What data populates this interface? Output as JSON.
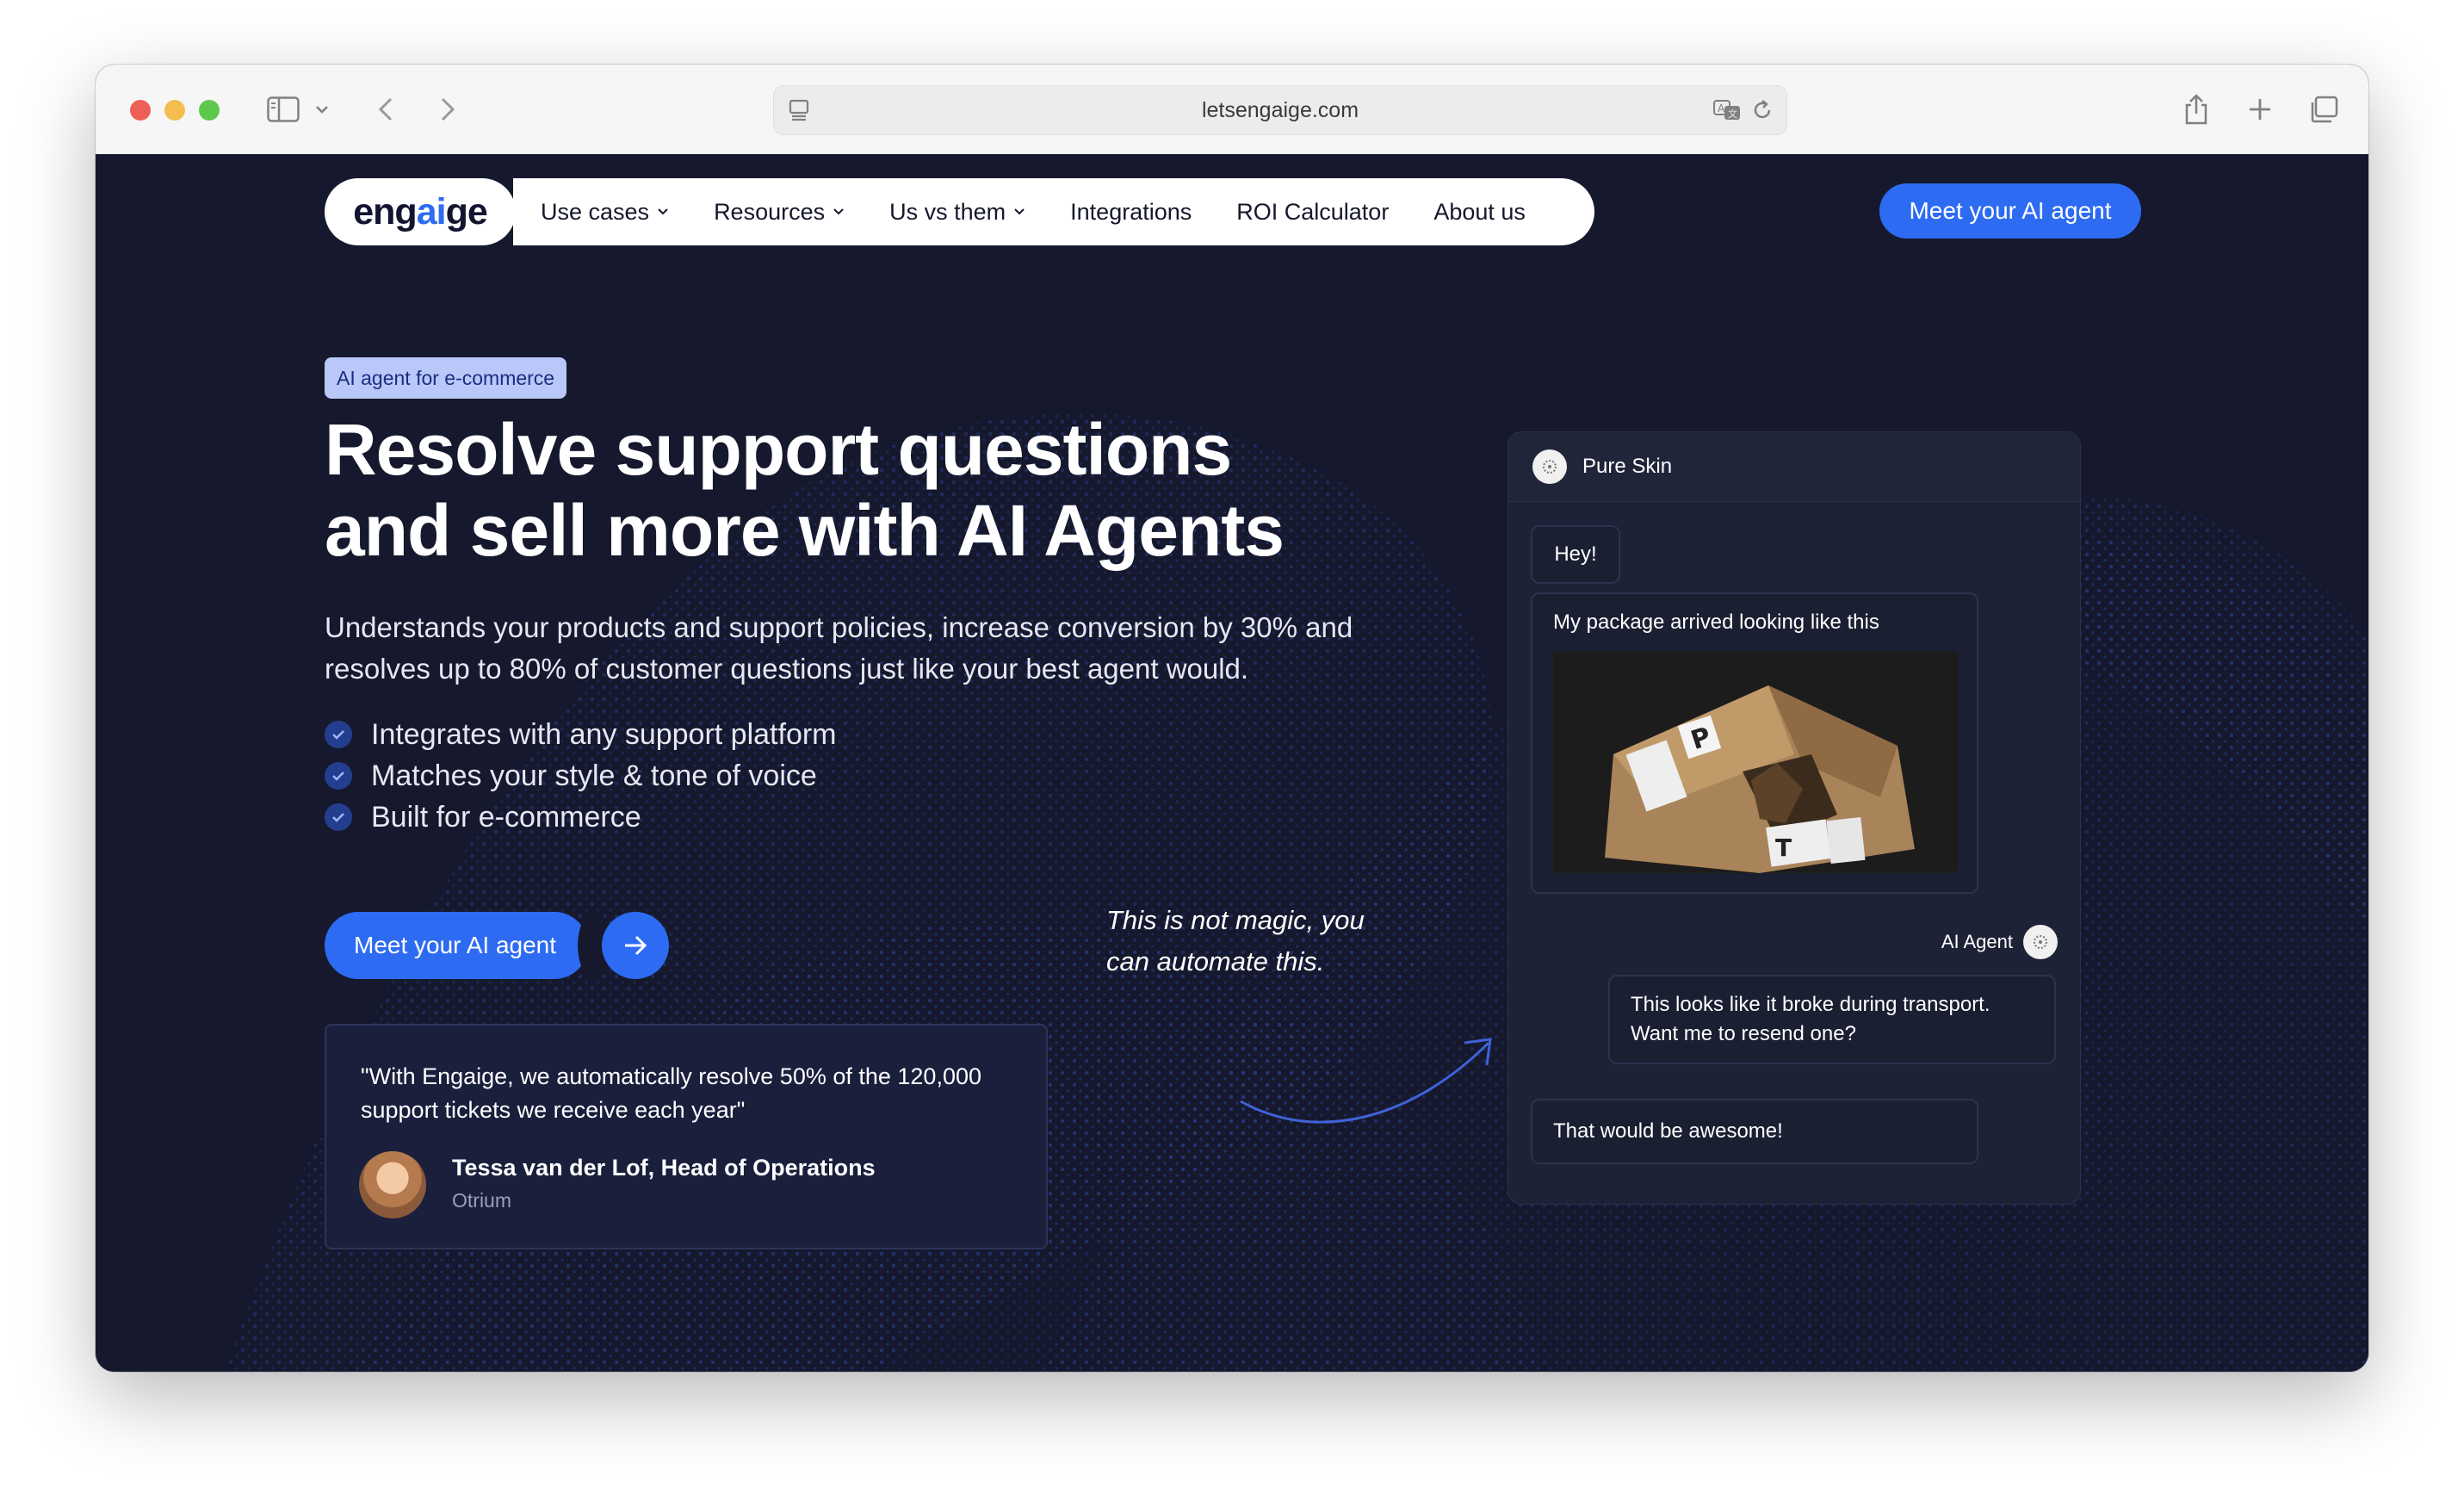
{
  "browser": {
    "url": "letsengaige.com"
  },
  "nav": {
    "logo_pre": "eng",
    "logo_ai": "ai",
    "logo_post": "ge",
    "items": [
      {
        "label": "Use cases",
        "has_dropdown": true
      },
      {
        "label": "Resources",
        "has_dropdown": true
      },
      {
        "label": "Us vs them",
        "has_dropdown": true
      },
      {
        "label": "Integrations",
        "has_dropdown": false
      },
      {
        "label": "ROI Calculator",
        "has_dropdown": false
      },
      {
        "label": "About us",
        "has_dropdown": false
      }
    ],
    "cta": "Meet your AI agent"
  },
  "hero": {
    "pill": "AI agent for e-commerce",
    "headline_line1": "Resolve support questions",
    "headline_line2": "and sell more with AI Agents",
    "subtitle": "Understands your products and support policies, increase conversion by 30% and resolves up to 80% of customer questions just like your best agent would.",
    "bullets": [
      "Integrates with any support platform",
      "Matches your style & tone of voice",
      "Built for e-commerce"
    ],
    "cta": "Meet your AI agent",
    "magic_note": "This is not magic, you can automate this."
  },
  "testimonial": {
    "quote": "\"With Engaige, we automatically resolve 50% of the 120,000 support tickets we receive each year\"",
    "name": "Tessa van der Lof, Head of Operations",
    "company": "Otrium"
  },
  "chat": {
    "title": "Pure Skin",
    "messages": {
      "hey": "Hey!",
      "package": "My package arrived looking like this",
      "agent_label": "AI Agent",
      "agent_reply": "This looks like it broke during transport. Want me to resend one?",
      "customer_reply": "That would be awesome!"
    }
  },
  "colors": {
    "page_bg": "#16192d",
    "accent": "#2d6bf2",
    "pill_bg": "#b9c8f8"
  }
}
